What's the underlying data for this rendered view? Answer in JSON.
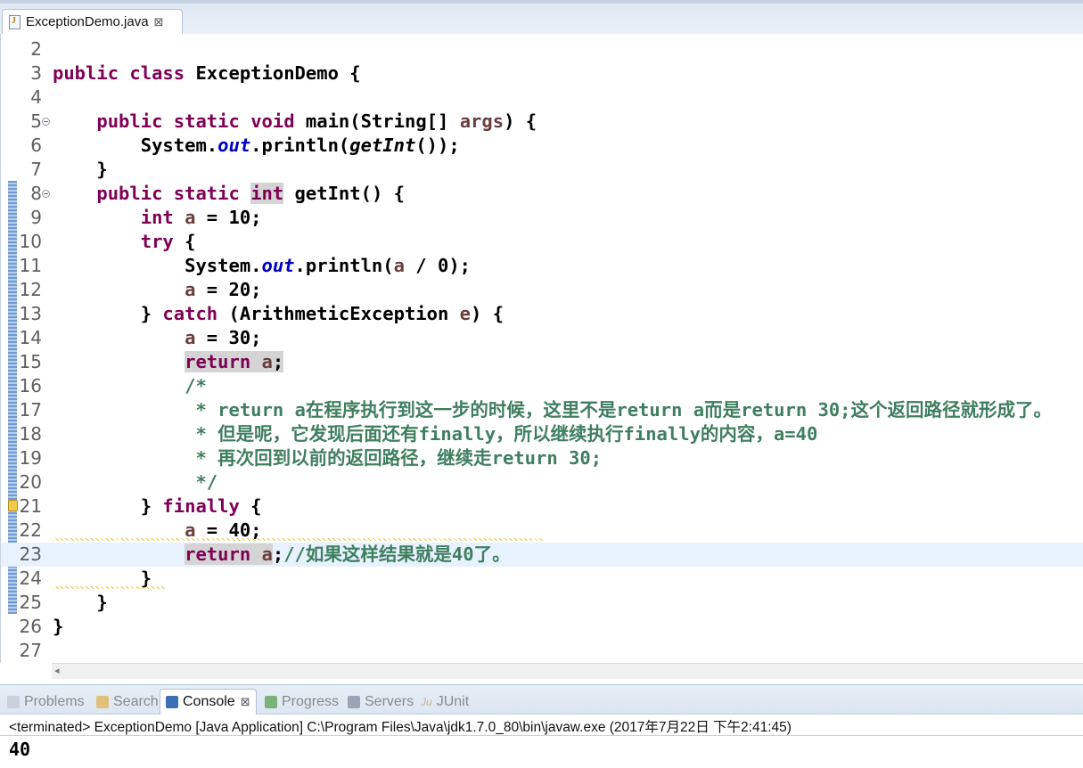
{
  "editor": {
    "tab_title": "ExceptionDemo.java",
    "close_glyph": "⊠"
  },
  "code": {
    "lines": [
      {
        "n": "2",
        "parts": []
      },
      {
        "n": "3",
        "parts": [
          {
            "c": "kw",
            "t": "public"
          },
          {
            "t": " "
          },
          {
            "c": "kw",
            "t": "class"
          },
          {
            "t": " ExceptionDemo {"
          }
        ]
      },
      {
        "n": "4",
        "parts": []
      },
      {
        "n": "5",
        "fold": true,
        "parts": [
          {
            "t": "    "
          },
          {
            "c": "kw",
            "t": "public"
          },
          {
            "t": " "
          },
          {
            "c": "kw",
            "t": "static"
          },
          {
            "t": " "
          },
          {
            "c": "kw",
            "t": "void"
          },
          {
            "t": " main(String[] "
          },
          {
            "c": "var",
            "t": "args"
          },
          {
            "t": ") {"
          }
        ]
      },
      {
        "n": "6",
        "parts": [
          {
            "t": "        System."
          },
          {
            "c": "fld",
            "t": "out"
          },
          {
            "t": ".println("
          },
          {
            "c": "ital",
            "t": "getInt"
          },
          {
            "t": "());"
          }
        ]
      },
      {
        "n": "7",
        "parts": [
          {
            "t": "    }"
          }
        ]
      },
      {
        "n": "8",
        "fold": true,
        "parts": [
          {
            "t": "    "
          },
          {
            "c": "kw",
            "t": "public"
          },
          {
            "t": " "
          },
          {
            "c": "kw",
            "t": "static"
          },
          {
            "t": " "
          },
          {
            "c": "kw hl",
            "t": "int"
          },
          {
            "t": " getInt() {"
          }
        ]
      },
      {
        "n": "9",
        "parts": [
          {
            "t": "        "
          },
          {
            "c": "kw",
            "t": "int"
          },
          {
            "t": " "
          },
          {
            "c": "var",
            "t": "a"
          },
          {
            "t": " = 10;"
          }
        ]
      },
      {
        "n": "10",
        "parts": [
          {
            "t": "        "
          },
          {
            "c": "kw",
            "t": "try"
          },
          {
            "t": " {"
          }
        ]
      },
      {
        "n": "11",
        "parts": [
          {
            "t": "            System."
          },
          {
            "c": "fld",
            "t": "out"
          },
          {
            "t": ".println("
          },
          {
            "c": "var",
            "t": "a"
          },
          {
            "t": " / 0);"
          }
        ]
      },
      {
        "n": "12",
        "parts": [
          {
            "t": "            "
          },
          {
            "c": "var",
            "t": "a"
          },
          {
            "t": " = 20;"
          }
        ]
      },
      {
        "n": "13",
        "parts": [
          {
            "t": "        } "
          },
          {
            "c": "kw",
            "t": "catch"
          },
          {
            "t": " (ArithmeticException "
          },
          {
            "c": "var",
            "t": "e"
          },
          {
            "t": ") {"
          }
        ]
      },
      {
        "n": "14",
        "parts": [
          {
            "t": "            "
          },
          {
            "c": "var",
            "t": "a"
          },
          {
            "t": " = 30;"
          }
        ]
      },
      {
        "n": "15",
        "parts": [
          {
            "t": "            "
          },
          {
            "c": "kw hl",
            "t": "return"
          },
          {
            "c": "hl",
            "t": " "
          },
          {
            "c": "var hl",
            "t": "a"
          },
          {
            "c": "hl",
            "t": ";"
          }
        ]
      },
      {
        "n": "16",
        "parts": [
          {
            "t": "            "
          },
          {
            "c": "cmt",
            "t": "/*"
          }
        ]
      },
      {
        "n": "17",
        "parts": [
          {
            "t": "             "
          },
          {
            "c": "cmt",
            "t": "* return a在程序执行到这一步的时候，这里不是return a而是return 30;这个返回路径就形成了。"
          }
        ]
      },
      {
        "n": "18",
        "parts": [
          {
            "t": "             "
          },
          {
            "c": "cmt",
            "t": "* 但是呢，它发现后面还有finally，所以继续执行finally的内容，a=40"
          }
        ]
      },
      {
        "n": "19",
        "parts": [
          {
            "t": "             "
          },
          {
            "c": "cmt",
            "t": "* 再次回到以前的返回路径，继续走return 30;"
          }
        ]
      },
      {
        "n": "20",
        "parts": [
          {
            "t": "             "
          },
          {
            "c": "cmt",
            "t": "*/"
          }
        ]
      },
      {
        "n": "21",
        "warn": true,
        "parts": [
          {
            "t": "        } "
          },
          {
            "c": "kw",
            "t": "finally"
          },
          {
            "t": " {"
          }
        ]
      },
      {
        "n": "22",
        "parts": [
          {
            "t": "            "
          },
          {
            "c": "var",
            "t": "a"
          },
          {
            "t": " = 40;"
          }
        ]
      },
      {
        "n": "23",
        "current": true,
        "parts": [
          {
            "t": "            "
          },
          {
            "c": "kw hl",
            "t": "return"
          },
          {
            "c": "hl",
            "t": " "
          },
          {
            "c": "var hl",
            "t": "a"
          },
          {
            "t": ";"
          },
          {
            "c": "cmt",
            "t": "//如果这样结果就是40了。"
          }
        ]
      },
      {
        "n": "24",
        "parts": [
          {
            "t": "        }"
          }
        ]
      },
      {
        "n": "25",
        "parts": [
          {
            "t": "    }"
          }
        ]
      },
      {
        "n": "26",
        "parts": [
          {
            "t": "}"
          }
        ]
      },
      {
        "n": "27",
        "parts": []
      }
    ]
  },
  "views": {
    "tabs": [
      {
        "id": "problems",
        "label": "Problems",
        "icon": "problems-icon",
        "color": "#c9d2dc"
      },
      {
        "id": "search",
        "label": "Search",
        "icon": "search-icon",
        "color": "#e3c07a"
      },
      {
        "id": "console",
        "label": "Console",
        "icon": "console-icon",
        "color": "#3c6fb4",
        "active": true
      },
      {
        "id": "progress",
        "label": "Progress",
        "icon": "progress-icon",
        "color": "#7ab37a"
      },
      {
        "id": "servers",
        "label": "Servers",
        "icon": "servers-icon",
        "color": "#9aa6b3"
      },
      {
        "id": "junit",
        "label": "JUnit",
        "icon": "junit-icon",
        "color": "#c7b48a"
      }
    ],
    "junit_prefix": "Ju",
    "status": "<terminated> ExceptionDemo [Java Application] C:\\Program Files\\Java\\jdk1.7.0_80\\bin\\javaw.exe (2017年7月22日 下午2:41:45)",
    "output": "40"
  }
}
